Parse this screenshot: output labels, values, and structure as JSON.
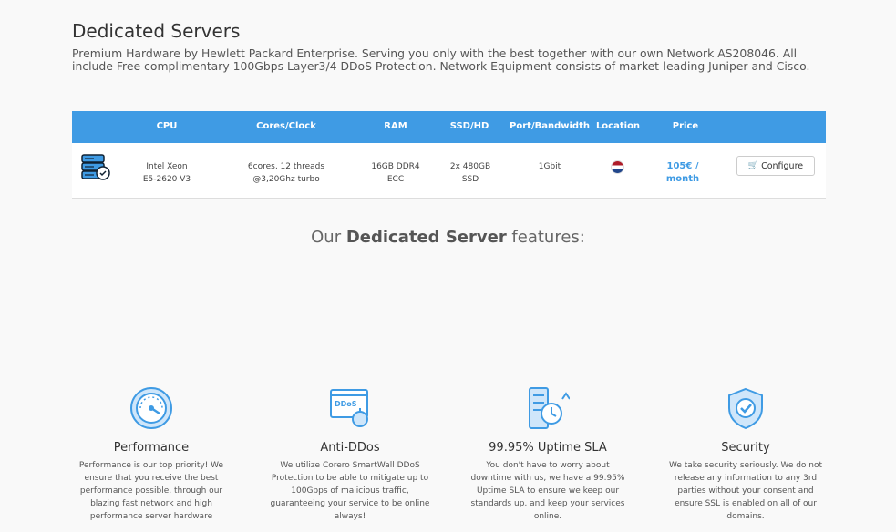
{
  "header": {
    "title": "Dedicated Servers",
    "intro": "Premium Hardware by Hewlett Packard Enterprise. Serving you only with the best together with our own Network AS208046. All include Free complimentary 100Gbps Layer3/4 DDoS Protection. Network Equipment consists of market-leading Juniper and Cisco."
  },
  "table": {
    "columns": [
      "CPU",
      "Cores/Clock",
      "RAM",
      "SSD/HD",
      "Port/Bandwidth",
      "Location",
      "Price"
    ],
    "row": {
      "cpu_line1": "Intel Xeon",
      "cpu_line2": "E5-2620 V3",
      "cores_line1": "6cores, 12 threads",
      "cores_line2": "@3,20Ghz turbo",
      "ram_line1": "16GB DDR4",
      "ram_line2": "ECC",
      "disk_line1": "2x 480GB",
      "disk_line2": "SSD",
      "bandwidth": "1Gbit",
      "location_flag": "netherlands-flag",
      "price_line1": "105€ /",
      "price_line2": "month",
      "configure_label": "Configure"
    }
  },
  "features": {
    "heading_prefix": "Our ",
    "heading_bold": "Dedicated Server",
    "heading_suffix": " features:",
    "items": [
      {
        "icon": "speedometer-icon",
        "title": "Performance",
        "text": "Performance is our top priority! We ensure that you receive the best performance possible, through our blazing fast network and high performance server hardware"
      },
      {
        "icon": "ddos-browser-icon",
        "title": "Anti-DDos",
        "text": "We utilize Corero SmartWall DDoS Protection to be able to mitigate up to 100Gbps of malicious traffic, guaranteeing your service to be online always!"
      },
      {
        "icon": "server-uptime-icon",
        "title": "99.95% Uptime SLA",
        "text": "You don't have to worry about downtime with us, we have a 99.95% Uptime SLA to ensure we keep our standards up, and keep your services online."
      },
      {
        "icon": "shield-check-icon",
        "title": "Security",
        "text": "We take security seriously. We do not release any information to any 3rd parties without your consent and ensure SSL is enabled on all of our domains."
      }
    ]
  },
  "colors": {
    "accent": "#3f9be4",
    "background": "#f9f9f9"
  }
}
